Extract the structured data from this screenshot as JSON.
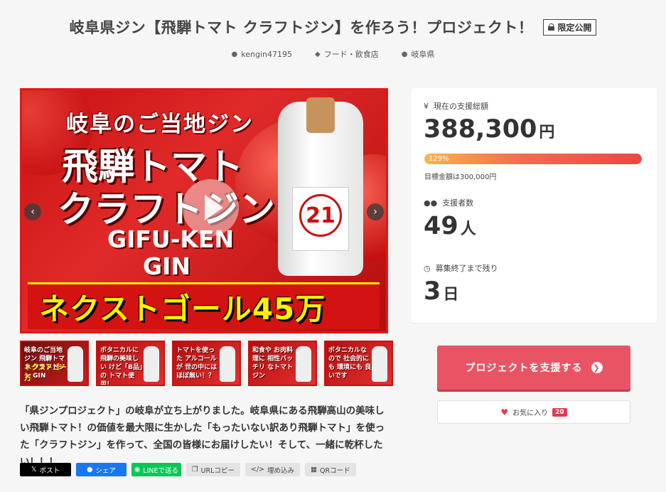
{
  "header": {
    "title": "岐阜県ジン【飛騨トマト クラフトジン】を作ろう！プロジェクト！",
    "private_badge": "限定公開",
    "owner": "kengin47195",
    "category": "フード・飲食店",
    "location": "岐阜県"
  },
  "main_image": {
    "line1": "岐阜のご当地ジン",
    "line2": "飛騨トマト",
    "line3": "クラフトジン",
    "line4": "GIFU-KEN",
    "line5": "GIN",
    "banner": "ネクストゴール45万",
    "bottle_number": "21"
  },
  "thumbnails": [
    {
      "text": "岐阜のご当地ジン 飛騨トマト クラフトジン GIN",
      "sub": "ネクストゴール45万"
    },
    {
      "text": "ボタニカルに 飛騨の美味しい けど「B品」の トマト使用！"
    },
    {
      "text": "トマトを使った アルコールが 世の中には ほぼ無い！？"
    },
    {
      "text": "和食や お肉料理に 相性バッチリ なトマトジン"
    },
    {
      "text": "ボタニカルなので 社会的にも 環境にも 良いです"
    }
  ],
  "description": "「県ジンプロジェクト」の岐阜が立ち上がりました。岐阜県にある飛騨高山の美味しい飛騨トマト！の価値を最大限に生かした「もったいない訳あり飛騨トマト」を使った「クラフトジン」を作って、全国の皆様にお届けしたい！そして、一緒に乾杯したい！！！",
  "share": {
    "x_label": "ポスト",
    "fb_label": "シェア",
    "line_label": "LINEで送る",
    "url_label": "URLコピー",
    "embed_label": "埋め込み",
    "qr_label": "QRコード"
  },
  "stats": {
    "total_label": "現在の支援総額",
    "total_value": "388,300",
    "total_unit": "円",
    "progress_label": "129%",
    "progress_fraction": 1.0,
    "goal_text": "目標金額は300,000円",
    "supporters_label": "支援者数",
    "supporters_value": "49",
    "supporters_unit": "人",
    "remaining_label": "募集終了まで残り",
    "remaining_value": "3",
    "remaining_unit": "日"
  },
  "actions": {
    "support_label": "プロジェクトを支援する",
    "favorite_label": "お気に入り",
    "favorite_count": "20"
  },
  "colors": {
    "accent": "#e95464",
    "facebook": "#1877f2",
    "line": "#06c755"
  }
}
